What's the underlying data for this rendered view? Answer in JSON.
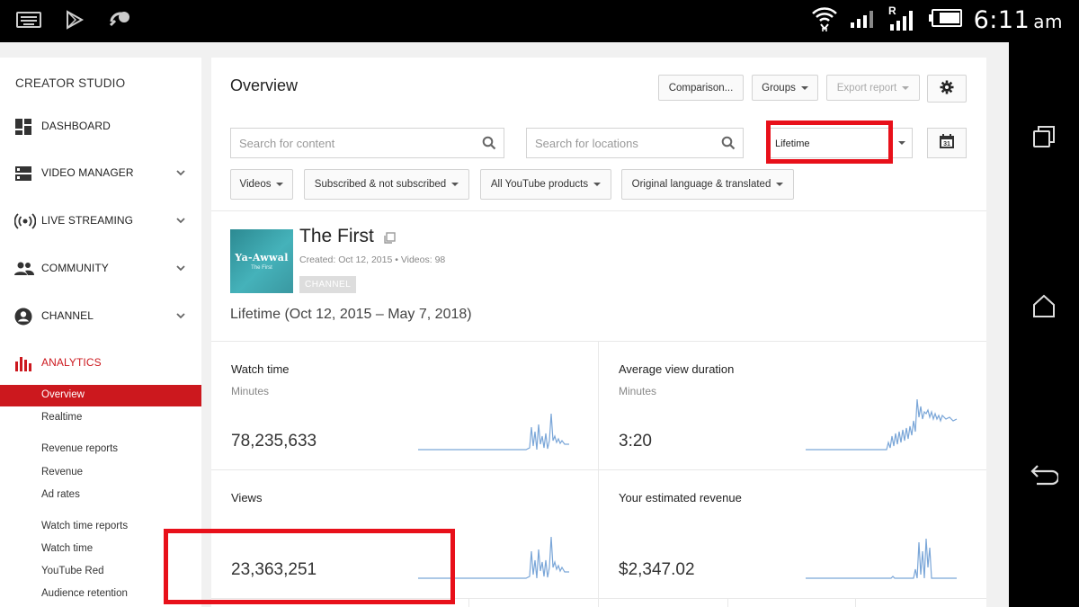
{
  "status_bar": {
    "time": "6:11",
    "ampm": "am"
  },
  "sidebar": {
    "title": "CREATOR STUDIO",
    "items": [
      {
        "label": "DASHBOARD",
        "icon": "dashboard-icon"
      },
      {
        "label": "VIDEO MANAGER",
        "icon": "video-manager-icon"
      },
      {
        "label": "LIVE STREAMING",
        "icon": "live-streaming-icon"
      },
      {
        "label": "COMMUNITY",
        "icon": "community-icon"
      },
      {
        "label": "CHANNEL",
        "icon": "channel-icon"
      },
      {
        "label": "ANALYTICS",
        "icon": "analytics-icon"
      }
    ],
    "sub_items": [
      {
        "label": "Overview"
      },
      {
        "label": "Realtime"
      },
      {
        "label": "Revenue reports"
      },
      {
        "label": "Revenue"
      },
      {
        "label": "Ad rates"
      },
      {
        "label": "Watch time reports"
      },
      {
        "label": "Watch time"
      },
      {
        "label": "YouTube Red"
      },
      {
        "label": "Audience retention"
      }
    ],
    "accent_color": "#cc181e"
  },
  "main": {
    "title": "Overview",
    "buttons": {
      "comparison": "Comparison...",
      "groups": "Groups",
      "export": "Export report"
    },
    "search_content": {
      "placeholder": "Search for content"
    },
    "search_locations": {
      "placeholder": "Search for locations"
    },
    "date_range": {
      "value": "Lifetime"
    },
    "calendar_day": "31",
    "filters": [
      {
        "label": "Videos"
      },
      {
        "label": "Subscribed & not subscribed"
      },
      {
        "label": "All YouTube products"
      },
      {
        "label": "Original language & translated"
      }
    ],
    "channel": {
      "thumb_text": "Ya-Awwal",
      "thumb_sub": "The First",
      "name": "The First",
      "meta": "Created: Oct 12, 2015  •  Videos: 98",
      "badge": "CHANNEL"
    },
    "range_text": "Lifetime (Oct 12, 2015 – May 7, 2018)",
    "metrics": [
      {
        "title": "Watch time",
        "unit": "Minutes",
        "value": "78,235,633"
      },
      {
        "title": "Average view duration",
        "unit": "Minutes",
        "value": "3:20"
      },
      {
        "title": "Views",
        "unit": "",
        "value": "23,363,251"
      },
      {
        "title": "Your estimated revenue",
        "unit": "",
        "value": "$2,347.02"
      }
    ],
    "sparkline_color": "#7aa6d8",
    "highlight_color": "#e8101a"
  }
}
